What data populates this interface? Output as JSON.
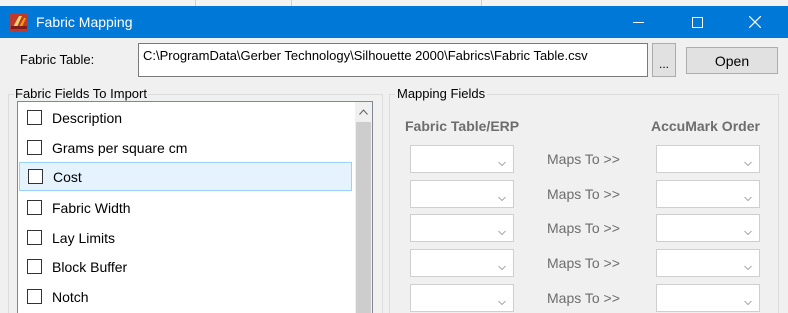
{
  "window": {
    "title": "Fabric Mapping",
    "controls": {
      "minimize_icon": "minimize-icon",
      "maximize_icon": "maximize-icon",
      "close_icon": "close-icon"
    }
  },
  "fabric_table": {
    "label": "Fabric Table:",
    "path": "C:\\ProgramData\\Gerber Technology\\Silhouette 2000\\Fabrics\\Fabric Table.csv",
    "browse_label": "...",
    "open_label": "Open"
  },
  "import_fields": {
    "group_title": "Fabric Fields To Import",
    "items": [
      {
        "label": "Description",
        "checked": false,
        "selected": false
      },
      {
        "label": "Grams per square cm",
        "checked": false,
        "selected": false
      },
      {
        "label": "Cost",
        "checked": false,
        "selected": true
      },
      {
        "label": "Fabric Width",
        "checked": false,
        "selected": false
      },
      {
        "label": "Lay Limits",
        "checked": false,
        "selected": false
      },
      {
        "label": "Block Buffer",
        "checked": false,
        "selected": false
      },
      {
        "label": "Notch",
        "checked": false,
        "selected": false
      }
    ]
  },
  "mapping": {
    "group_title": "Mapping Fields",
    "col_left": "Fabric Table/ERP",
    "col_right": "AccuMark Order",
    "rows": [
      {
        "maps_label": "Maps To >>",
        "left_value": "",
        "right_value": ""
      },
      {
        "maps_label": "Maps To >>",
        "left_value": "",
        "right_value": ""
      },
      {
        "maps_label": "Maps To >>",
        "left_value": "",
        "right_value": ""
      },
      {
        "maps_label": "Maps To >>",
        "left_value": "",
        "right_value": ""
      },
      {
        "maps_label": "Maps To >>",
        "left_value": "",
        "right_value": ""
      }
    ]
  },
  "colors": {
    "titlebar": "#0078d7",
    "selection": "#e5f3ff",
    "selection_border": "#99d1ff",
    "disabled_text": "#6d6d6d"
  }
}
